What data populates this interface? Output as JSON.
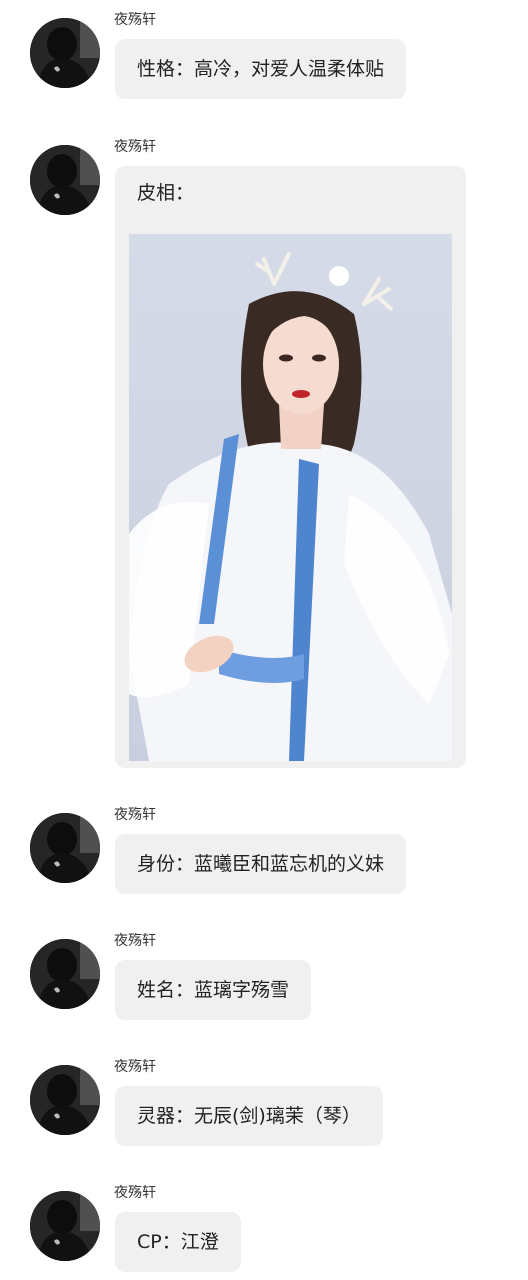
{
  "messages": [
    {
      "sender": "夜殇轩",
      "text": "性格：高冷，对爱人温柔体贴"
    },
    {
      "sender": "夜殇轩",
      "text": "皮相：",
      "image": "portrait-photo"
    },
    {
      "sender": "夜殇轩",
      "text": "身份：蓝曦臣和蓝忘机的义妹"
    },
    {
      "sender": "夜殇轩",
      "text": "姓名：蓝璃字殇雪"
    },
    {
      "sender": "夜殇轩",
      "text": "灵器：无辰(剑)璃茉（琴）"
    },
    {
      "sender": "夜殇轩",
      "text": "CP：江澄"
    }
  ],
  "colors": {
    "bubble": "#f0f0f0",
    "text": "#222222",
    "sender": "#333333",
    "background": "#ffffff"
  },
  "icons": {
    "avatar": "avatar-dark-hooded-figure"
  }
}
